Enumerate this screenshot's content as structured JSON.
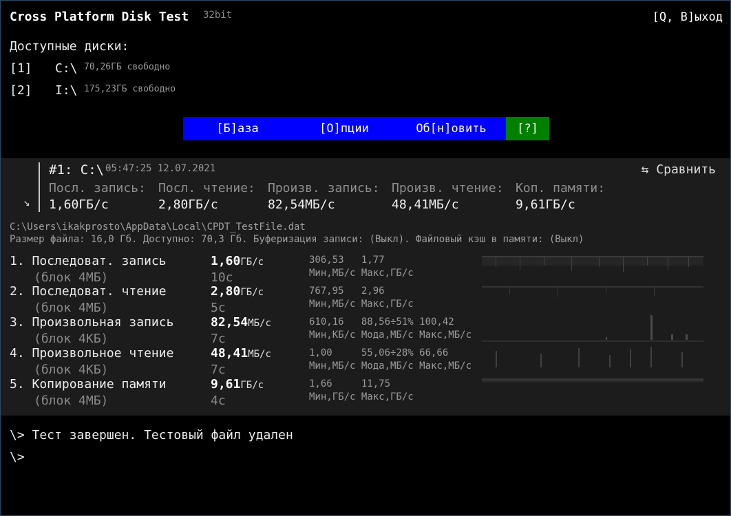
{
  "app": {
    "title": "Cross Platform Disk Test",
    "bits": "32bit",
    "exit_label": "[Q, В]ыход"
  },
  "disks": {
    "label": "Доступные диски:",
    "items": [
      {
        "num": "[1]",
        "letter": "C:\\",
        "free": "70,26ГБ свободно"
      },
      {
        "num": "[2]",
        "letter": "I:\\",
        "free": "175,23ГБ свободно"
      }
    ]
  },
  "menu": {
    "items": [
      {
        "label": "[Б]аза"
      },
      {
        "label": "[О]пции"
      },
      {
        "label": "Об[н]овить"
      },
      {
        "label": "[?]"
      }
    ],
    "colors": {
      "menu_bg": "#0000ff",
      "help_bg": "#008000"
    }
  },
  "result": {
    "title": "#1: C:\\",
    "time": "05:47:25 12.07.2021",
    "compare_label": "⇆ Сравнить",
    "arrow_icon": "↘",
    "summary": [
      {
        "head": "Посл. запись:",
        "value": "1,60ГБ/с"
      },
      {
        "head": "Посл. чтение:",
        "value": "2,80ГБ/с"
      },
      {
        "head": "Произв. запись:",
        "value": "82,54МБ/с"
      },
      {
        "head": "Произв. чтение:",
        "value": "48,41МБ/с"
      },
      {
        "head": "Коп. памяти:",
        "value": "9,61ГБ/с"
      }
    ],
    "file_path": "C:\\Users\\ikakprosto\\AppData\\Local\\CPDT_TestFile.dat",
    "file_info": "Размер файла: 16,0 Гб. Доступно: 70,3 Гб. Буферизация записи: (Выкл). Файловый кэш в памяти: (Выкл)",
    "tests": [
      {
        "name": "1. Последоват. запись",
        "block": "(блок 4МБ)",
        "value": "1,60",
        "unit": "ГБ/с",
        "time": "10с",
        "stats_top": "306,53   1,77",
        "stats_bottom": "Мин,МБ/с Макс,ГБ/с"
      },
      {
        "name": "2. Последоват. чтение",
        "block": "(блок 4МБ)",
        "value": "2,80",
        "unit": "ГБ/с",
        "time": "5с",
        "stats_top": "767,95   2,96",
        "stats_bottom": "Мин,МБ/с Макс,ГБ/с"
      },
      {
        "name": "3. Произвольная запись",
        "block": "(блок 4КБ)",
        "value": "82,54",
        "unit": "МБ/с",
        "time": "7с",
        "stats_top": "610,16   88,56÷51% 100,42",
        "stats_bottom": "Мин,КБ/с Мода,МБ/с Макс,МБ/с"
      },
      {
        "name": "4. Произвольное чтение",
        "block": "(блок 4КБ)",
        "value": "48,41",
        "unit": "МБ/с",
        "time": "7с",
        "stats_top": "1,00     55,06÷28% 66,66",
        "stats_bottom": "Мин,МБ/с Мода,МБ/с Макс,МБ/с"
      },
      {
        "name": "5. Копирование памяти",
        "block": "(блок 4МБ)",
        "value": "9,61",
        "unit": "ГБ/с",
        "time": "4с",
        "stats_top": "1,66     11,75",
        "stats_bottom": "Мин,ГБ/с Макс,ГБ/с"
      }
    ]
  },
  "console": {
    "lines": [
      "\\> Тест завершен. Тестовый файл удален",
      "\\>"
    ]
  }
}
